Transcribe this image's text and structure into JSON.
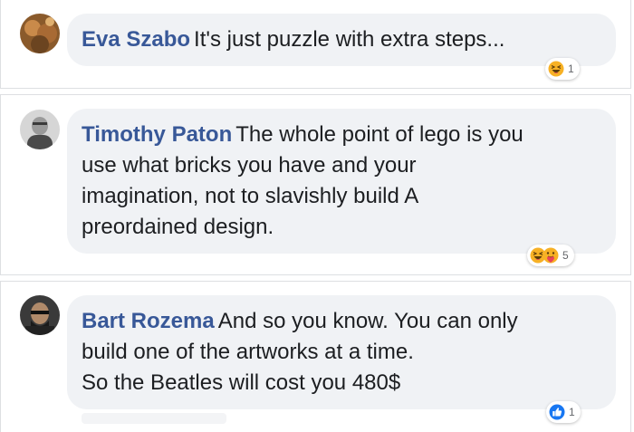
{
  "comments": [
    {
      "author": "Eva Szabo",
      "lines": [
        "It's just puzzle with extra steps..."
      ],
      "reactions": {
        "icons": [
          "haha-icon"
        ],
        "count": "1"
      }
    },
    {
      "author": "Timothy Paton",
      "lines": [
        "The whole point of lego is you",
        "use what bricks you have and your",
        "imagination, not to slavishly build A",
        "preordained design."
      ],
      "reactions": {
        "icons": [
          "haha-icon",
          "care-icon"
        ],
        "count": "5"
      }
    },
    {
      "author": "Bart Rozema",
      "lines": [
        "And so you know. You can only",
        "build one of the artworks at a time.",
        "So the Beatles will cost you 480$"
      ],
      "reactions": {
        "icons": [
          "like-icon"
        ],
        "count": "1"
      }
    }
  ],
  "colors": {
    "author": "#385898",
    "bubble": "#f0f2f5",
    "like": "#1877f2",
    "haha": "#f7b125"
  }
}
